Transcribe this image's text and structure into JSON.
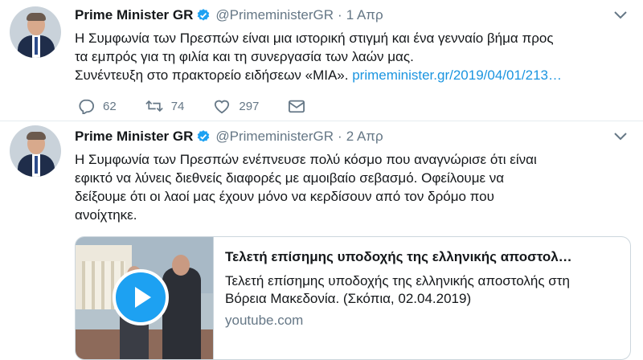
{
  "tweets": [
    {
      "author_name": "Prime Minister GR",
      "handle": "@PrimeministerGR",
      "time": "1 Απρ",
      "text_lines": [
        "Η Συμφωνία των Πρεσπών είναι μια ιστορική στιγμή και ένα γενναίο βήμα προς",
        "τα εμπρός για τη φιλία και τη συνεργασία των λαών μας.",
        "Συνέντευξη στο πρακτορείο ειδήσεων «ΜΙΑ». "
      ],
      "link_text": "primeminister.gr/2019/04/01/213…",
      "actions": {
        "replies": "62",
        "retweets": "74",
        "likes": "297"
      }
    },
    {
      "author_name": "Prime Minister GR",
      "handle": "@PrimeministerGR",
      "time": "2 Απρ",
      "text_lines": [
        "Η Συμφωνία των Πρεσπών ενέπνευσε πολύ κόσμο που αναγνώρισε ότι είναι",
        "εφικτό να λύνεις διεθνείς διαφορές με αμοιβαίο σεβασμό. Οφείλουμε να",
        "δείξουμε ότι οι λαοί μας έχουν μόνο να κερδίσουν από τον δρόμο που",
        "ανοίχτηκε."
      ],
      "card": {
        "title": "Τελετή επίσημης υποδοχής της ελληνικής αποστολ…",
        "description_lines": [
          "Τελετή επίσημης υποδοχής της ελληνικής αποστολής στη",
          "Βόρεια Μακεδονία. (Σκόπια, 02.04.2019)"
        ],
        "domain": "youtube.com"
      }
    }
  ],
  "icons": {
    "verified": "verified-badge-icon",
    "caret": "chevron-down-icon",
    "reply": "reply-icon",
    "retweet": "retweet-icon",
    "like": "heart-icon",
    "dm": "mail-icon",
    "play": "play-icon"
  },
  "colors": {
    "link": "#1b95e0",
    "secondary_text": "#657786",
    "verified": "#1da1f2",
    "play_button": "#1da1f2"
  }
}
